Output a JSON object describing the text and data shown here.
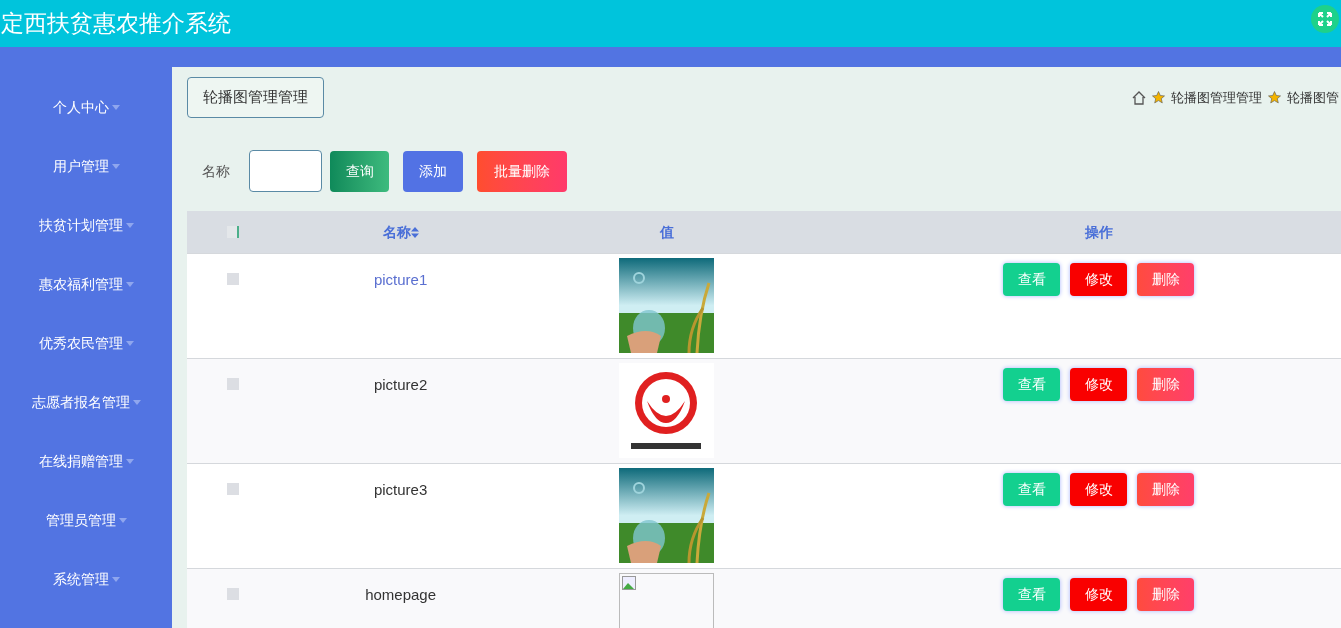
{
  "window": {
    "title": "定西扶贫惠农推介系统"
  },
  "sidebar": {
    "items": [
      {
        "label": "个人中心"
      },
      {
        "label": "用户管理"
      },
      {
        "label": "扶贫计划管理"
      },
      {
        "label": "惠农福利管理"
      },
      {
        "label": "优秀农民管理"
      },
      {
        "label": "志愿者报名管理"
      },
      {
        "label": "在线捐赠管理"
      },
      {
        "label": "管理员管理"
      },
      {
        "label": "系统管理"
      }
    ]
  },
  "page_title": "轮播图管理管理",
  "breadcrumb": [
    "轮播图管理管理",
    "轮播图管"
  ],
  "search": {
    "label": "名称",
    "buttons": [
      {
        "label": "查询",
        "kind": "search"
      },
      {
        "label": "添加",
        "kind": "add"
      },
      {
        "label": "批量删除",
        "kind": "delete"
      }
    ]
  },
  "table": {
    "all_checked": false,
    "columns": [
      "名称",
      "值",
      "操作"
    ],
    "rows": [
      {
        "name": "picture1",
        "highlighted": true,
        "checked": false,
        "kind": "picture",
        "actions": [
          "查看",
          "修改",
          "删除"
        ]
      },
      {
        "name": "picture2",
        "highlighted": false,
        "checked": false,
        "kind": "picture",
        "actions": [
          "查看",
          "修改",
          "删除"
        ]
      },
      {
        "name": "picture3",
        "highlighted": false,
        "checked": false,
        "kind": "picture",
        "actions": [
          "查看",
          "修改",
          "删除"
        ]
      },
      {
        "name": "homepage",
        "highlighted": false,
        "checked": false,
        "kind": "broken",
        "actions": [
          "查看",
          "修改",
          "删除"
        ]
      }
    ]
  }
}
